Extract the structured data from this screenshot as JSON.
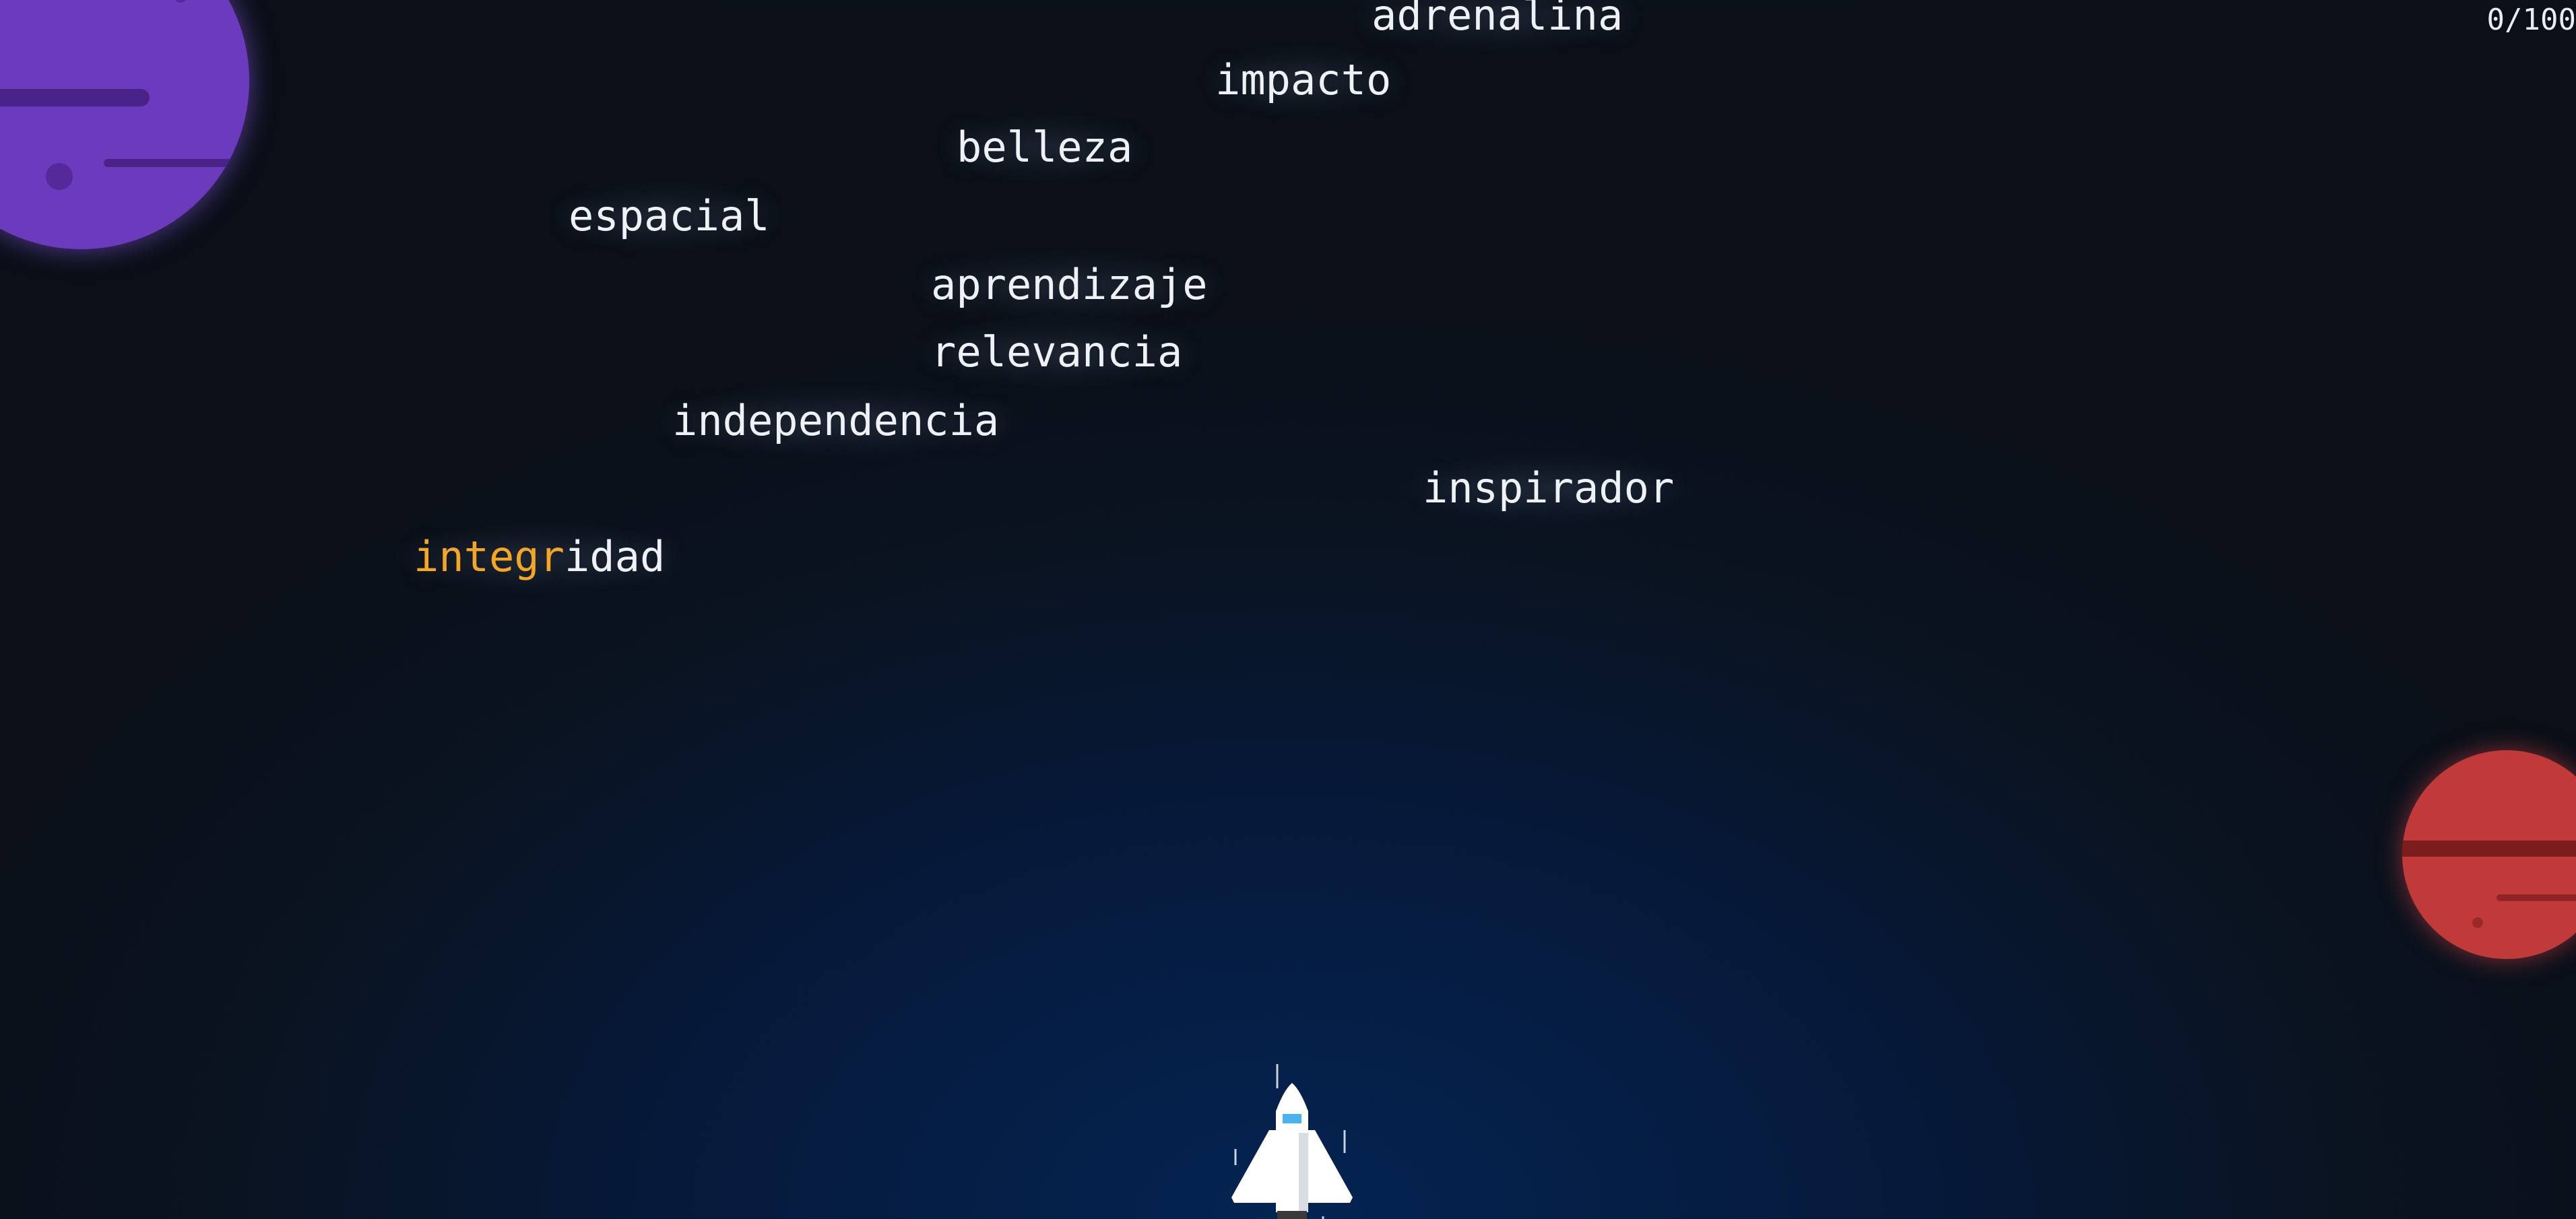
{
  "hud": {
    "progress_text": "0/100",
    "progress": {
      "completed": 0,
      "total": 100
    }
  },
  "words": [
    {
      "text": "adrenalina",
      "typed": "",
      "rest": "adrenalina"
    },
    {
      "text": "impacto",
      "typed": "",
      "rest": "impacto"
    },
    {
      "text": "belleza",
      "typed": "",
      "rest": "belleza"
    },
    {
      "text": "espacial",
      "typed": "",
      "rest": "espacial"
    },
    {
      "text": "aprendizaje",
      "typed": "",
      "rest": "aprendizaje"
    },
    {
      "text": "relevancia",
      "typed": "",
      "rest": "relevancia"
    },
    {
      "text": "independencia",
      "typed": "",
      "rest": "independencia"
    },
    {
      "text": "inspirador",
      "typed": "",
      "rest": "inspirador"
    },
    {
      "text": "integridad",
      "typed": "integr",
      "rest": "idad"
    }
  ],
  "colors": {
    "typed_letters": "#f5a623",
    "word_text": "#eef1f6",
    "planet_purple": "#6c3bbd",
    "planet_red": "#c03a3a"
  },
  "icons": {
    "player": "spaceship-icon",
    "decor_1": "purple-planet",
    "decor_2": "red-planet"
  }
}
